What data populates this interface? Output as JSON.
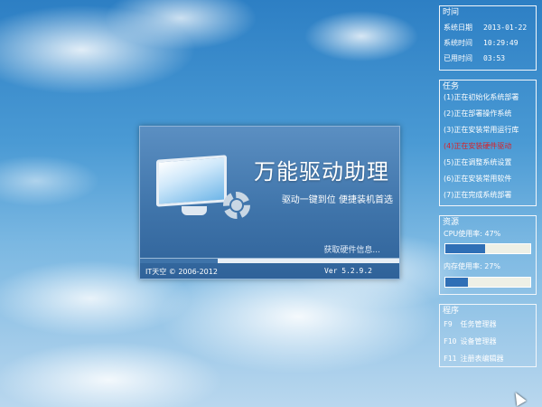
{
  "splash": {
    "title": "万能驱动助理",
    "subtitle": "驱动一键到位 便捷装机首选",
    "status": "获取硬件信息...",
    "progress_percent": 30,
    "copyright": "IT天空 © 2006-2012",
    "version": "Ver 5.2.9.2"
  },
  "time_panel": {
    "heading": "时间",
    "rows": [
      {
        "label": "系统日期",
        "value": "2013-01-22"
      },
      {
        "label": "系统时间",
        "value": "10:29:49"
      },
      {
        "label": "已用时间",
        "value": "03:53"
      }
    ]
  },
  "task_panel": {
    "heading": "任务",
    "items": [
      {
        "label": "(1)正在初始化系统部署",
        "active": false
      },
      {
        "label": "(2)正在部署操作系统",
        "active": false
      },
      {
        "label": "(3)正在安装常用运行库",
        "active": false
      },
      {
        "label": "(4)正在安装硬件驱动",
        "active": true
      },
      {
        "label": "(5)正在调整系统设置",
        "active": false
      },
      {
        "label": "(6)正在安装常用软件",
        "active": false
      },
      {
        "label": "(7)正在完成系统部署",
        "active": false
      }
    ],
    "active_color": "#d8232a"
  },
  "resource_panel": {
    "heading": "资源",
    "cpu_label": "CPU使用率: 47%",
    "cpu_percent": 47,
    "mem_label": "内存使用率: 27%",
    "mem_percent": 27
  },
  "program_panel": {
    "heading": "程序",
    "items": [
      {
        "key": "F9",
        "label": "任务管理器"
      },
      {
        "key": "F10",
        "label": "设备管理器"
      },
      {
        "key": "F11",
        "label": "注册表编辑器"
      }
    ]
  },
  "icons": {
    "splash_logo": "monitor-icon",
    "splash_gear": "gear-icon",
    "cursor": "mouse-pointer-icon"
  }
}
